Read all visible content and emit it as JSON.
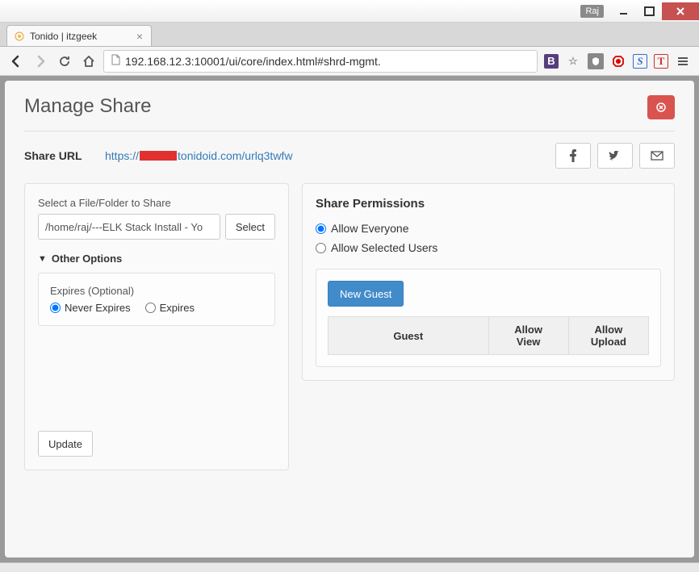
{
  "window": {
    "user_badge": "Raj"
  },
  "browser": {
    "tab_title": "Tonido | itzgeek",
    "url_display": "192.168.12.3:10001/ui/core/index.html#shrd-mgmt."
  },
  "page": {
    "title": "Manage Share",
    "share_url_label": "Share URL",
    "share_url_prefix": "https://",
    "share_url_suffix": "tonidoid.com/urlq3twfw",
    "left": {
      "select_label": "Select a File/Folder to Share",
      "path_value": "/home/raj/---ELK Stack Install - Yo",
      "select_btn": "Select",
      "other_options": "Other Options",
      "expires_label": "Expires (Optional)",
      "never_expires": "Never Expires",
      "expires": "Expires"
    },
    "right": {
      "section_title": "Share Permissions",
      "allow_everyone": "Allow Everyone",
      "allow_selected": "Allow Selected Users",
      "new_guest_btn": "New Guest",
      "th_guest": "Guest",
      "th_allow_view": "Allow View",
      "th_allow_upload": "Allow Upload"
    },
    "update_btn": "Update"
  }
}
